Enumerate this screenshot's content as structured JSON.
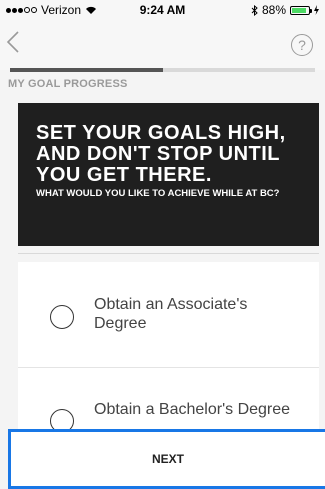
{
  "status_bar": {
    "carrier": "Verizon",
    "time": "9:24 AM",
    "battery": "88%",
    "signal_bars_filled": 3,
    "signal_bars_total": 5,
    "battery_level": 0.88,
    "battery_color": "#4cd964"
  },
  "nav": {
    "back_icon": "chevron-left-icon",
    "help_icon": "question-icon",
    "help_glyph": "?"
  },
  "progress": {
    "level": 0.5,
    "fill_color": "#555555"
  },
  "section": {
    "title": "MY GOAL PROGRESS"
  },
  "banner": {
    "title": "SET YOUR GOALS HIGH, AND DON'T STOP UNTIL YOU GET THERE.",
    "subtitle": "WHAT WOULD YOU LIKE TO ACHIEVE WHILE AT BC?"
  },
  "options": [
    {
      "label": "Obtain an Associate's Degree",
      "selected": false
    },
    {
      "label": "Obtain a Bachelor's Degree",
      "selected": false
    }
  ],
  "next_button": {
    "label": "NEXT",
    "border_color": "#1877e6"
  }
}
